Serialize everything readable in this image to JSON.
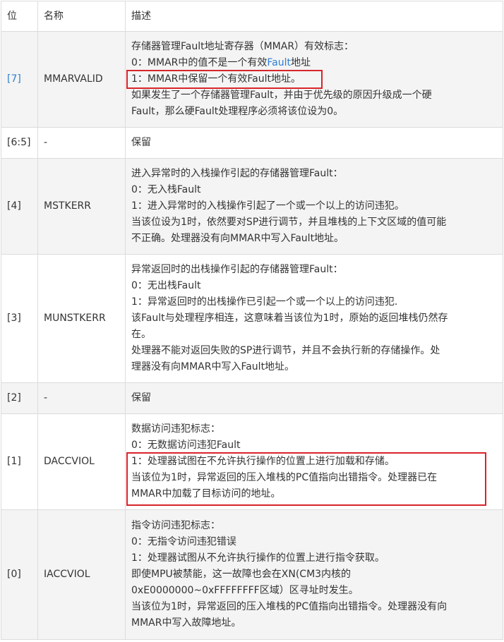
{
  "header": {
    "bit": "位",
    "name": "名称",
    "desc": "描述"
  },
  "rows": [
    {
      "bit": "[7]",
      "name": "MMARVALID",
      "lines": [
        "存储器管理Fault地址寄存器（MMAR）有效标志：",
        "0：MMAR中的值不是一个有效",
        "1：MMAR中保留一个有效Fault地址。",
        "如果发生了一个存储器管理Fault，并由于优先级的原因升级成一个硬",
        "Fault，那么硬Fault处理程序必须将该位设为0。"
      ],
      "link_word": "Fault",
      "line1_tail": "地址"
    },
    {
      "bit": "[6:5]",
      "name": "-",
      "lines": [
        "保留"
      ]
    },
    {
      "bit": "[4]",
      "name": "MSTKERR",
      "lines": [
        "进入异常时的入栈操作引起的存储器管理Fault：",
        "0：无入栈Fault",
        "1：进入异常时的入栈操作引起了一个或一个以上的访问违犯。",
        "当该位设为1时，依然要对SP进行调节，并且堆栈的上下文区域的值可能",
        "不正确。处理器没有向MMAR中写入Fault地址。"
      ]
    },
    {
      "bit": "[3]",
      "name": "MUNSTKERR",
      "lines": [
        "异常返回时的出栈操作引起的存储器管理Fault：",
        "0：无出栈Fault",
        "1：异常返回时的出栈操作已引起一个或一个以上的访问违犯.",
        "该Fault与处理程序相连，这意味着当该位为1时，原始的返回堆栈仍然存",
        "在。",
        "处理器不能对返回失败的SP进行调节，并且不会执行新的存储操作。处",
        "理器没有向MMAR中写入Fault地址。"
      ]
    },
    {
      "bit": "[2]",
      "name": "-",
      "lines": [
        "保留"
      ]
    },
    {
      "bit": "[1]",
      "name": "DACCVIOL",
      "lines": [
        "数据访问违犯标志：",
        "0：无数据访问违犯Fault",
        "1：处理器试图在不允许执行操作的位置上进行加载和存储。",
        "当该位为1时，异常返回的压入堆栈的PC值指向出错指令。处理器已在",
        "MMAR中加载了目标访问的地址。"
      ]
    },
    {
      "bit": "[0]",
      "name": "IACCVIOL",
      "lines": [
        "指令访问违犯标志：",
        "0：无指令访问违犯错误",
        "1：处理器试图从不允许执行操作的位置上进行指令获取。",
        "即使MPU被禁能，这一故障也会在XN(CM3内核的",
        "0xE0000000~0xFFFFFFFF区域）区寻址时发生。",
        "当该位为1时，异常返回的压入堆栈的PC值指向出错指令。处理器没有向",
        "MMAR中写入故障地址。"
      ]
    }
  ],
  "colors": {
    "border": "#dcdcdc",
    "alt_row": "#f4f4f4",
    "link": "#2f7fcf",
    "highlight_box": "#d9242b"
  }
}
